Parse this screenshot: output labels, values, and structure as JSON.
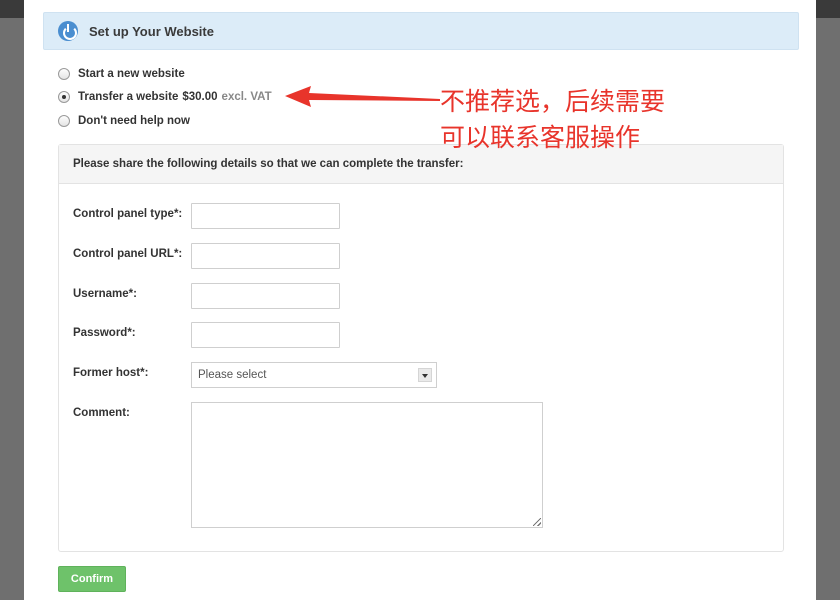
{
  "header": {
    "title": "Set up Your Website"
  },
  "options": [
    {
      "label": "Start a new website",
      "price": "",
      "note": "",
      "checked": false
    },
    {
      "label": "Transfer a website",
      "price": "$30.00",
      "note": "excl. VAT",
      "checked": true
    },
    {
      "label": "Don't need help now",
      "price": "",
      "note": "",
      "checked": false
    }
  ],
  "panel": {
    "heading": "Please share the following details so that we can complete the transfer:",
    "fields": {
      "control_panel_type": "Control panel type*:",
      "control_panel_url": "Control panel URL*:",
      "username": "Username*:",
      "password": "Password*:",
      "former_host": "Former host*:",
      "comment": "Comment:"
    },
    "former_host_selected": "Please select"
  },
  "confirm_label": "Confirm",
  "annotation": {
    "line1": "不推荐选，后续需要",
    "line2": "可以联系客服操作",
    "color": "#e8342b"
  },
  "colors": {
    "header_bg": "#dcecf8",
    "accent": "#4a8ed0",
    "confirm": "#6ec26a"
  }
}
